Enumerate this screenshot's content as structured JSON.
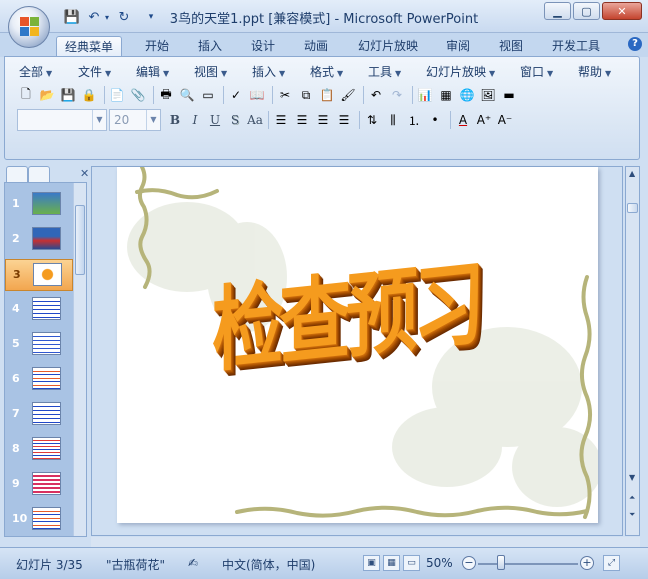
{
  "window": {
    "title": "3鸟的天堂1.ppt [兼容模式] - Microsoft PowerPoint",
    "minimize": "▁",
    "maximize": "▢",
    "close": "✕"
  },
  "ribbon_tabs": [
    "经典菜单",
    "开始",
    "插入",
    "设计",
    "动画",
    "幻灯片放映",
    "审阅",
    "视图",
    "开发工具"
  ],
  "help_label": "?",
  "classic_menu": [
    "全部",
    "文件",
    "编辑",
    "视图",
    "插入",
    "格式",
    "工具",
    "幻灯片放映",
    "窗口",
    "帮助"
  ],
  "font": {
    "name_value": "",
    "size_value": "20"
  },
  "format_buttons": [
    "B",
    "I",
    "U",
    "S",
    "Aa"
  ],
  "slides_pane": {
    "numbers": [
      "1",
      "2",
      "3",
      "4",
      "5",
      "6",
      "7",
      "8",
      "9",
      "10"
    ],
    "selected_index": 3
  },
  "slide": {
    "title": "检查预习"
  },
  "status_bar": {
    "slide_counter": "幻灯片 3/35",
    "theme": "\"古瓶荷花\"",
    "language": "中文(简体，中国)",
    "zoom": "50%"
  },
  "colors": {
    "title_fill": "#f59b1e",
    "title_extrude": "#8c3f00",
    "ribbon_bg": "#dde8f5",
    "selected_slide": "#f2a64f"
  }
}
